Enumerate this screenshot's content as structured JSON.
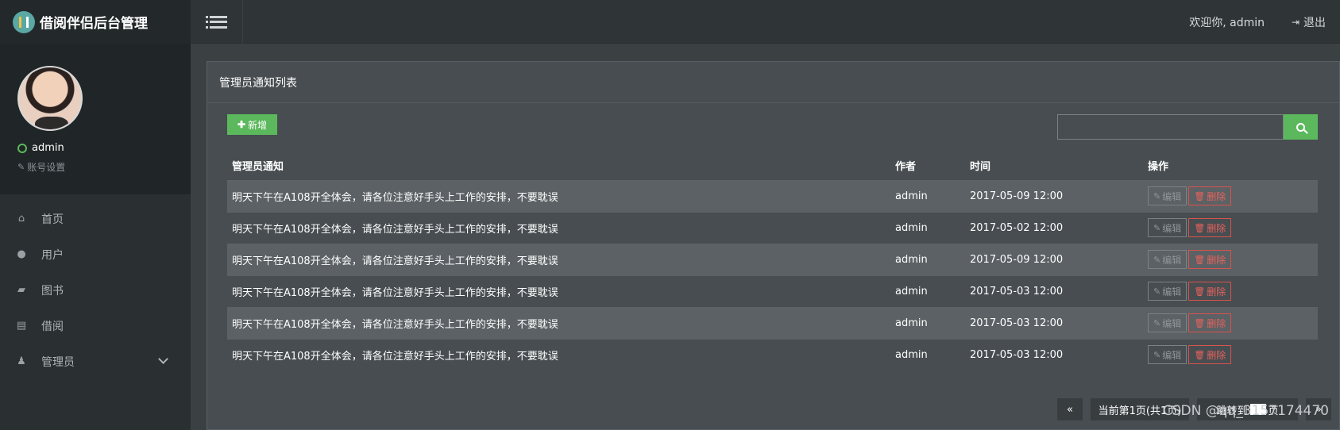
{
  "app": {
    "title": "借阅伴侣后台管理"
  },
  "topbar": {
    "welcome": "欢迎你, admin",
    "logout_label": "退出"
  },
  "profile": {
    "username": "admin",
    "account_settings": "账号设置"
  },
  "sidebar": {
    "items": [
      {
        "label": "首页",
        "icon": "home-icon"
      },
      {
        "label": "用户",
        "icon": "user-icon"
      },
      {
        "label": "图书",
        "icon": "book-icon"
      },
      {
        "label": "借阅",
        "icon": "calendar-icon"
      },
      {
        "label": "管理员",
        "icon": "admin-icon"
      }
    ]
  },
  "panel": {
    "title": "管理员通知列表",
    "add_label": "新增",
    "search_placeholder": ""
  },
  "table": {
    "headers": {
      "title": "管理员通知",
      "author": "作者",
      "time": "时间",
      "actions": "操作"
    },
    "edit_label": "编辑",
    "delete_label": "删除",
    "rows": [
      {
        "title": "明天下午在A108开全体会，请各位注意好手头上工作的安排，不要耽误",
        "author": "admin",
        "time": "2017-05-09 12:00"
      },
      {
        "title": "明天下午在A108开全体会，请各位注意好手头上工作的安排，不要耽误",
        "author": "admin",
        "time": "2017-05-02 12:00"
      },
      {
        "title": "明天下午在A108开全体会，请各位注意好手头上工作的安排，不要耽误",
        "author": "admin",
        "time": "2017-05-09 12:00"
      },
      {
        "title": "明天下午在A108开全体会，请各位注意好手头上工作的安排，不要耽误",
        "author": "admin",
        "time": "2017-05-03 12:00"
      },
      {
        "title": "明天下午在A108开全体会，请各位注意好手头上工作的安排，不要耽误",
        "author": "admin",
        "time": "2017-05-03 12:00"
      },
      {
        "title": "明天下午在A108开全体会，请各位注意好手头上工作的安排，不要耽误",
        "author": "admin",
        "time": "2017-05-03 12:00"
      }
    ]
  },
  "pager": {
    "prev": "«",
    "info": "当前第1页(共1页)",
    "jump_prefix": "跳转到",
    "jump_suffix": "页",
    "next": "»"
  },
  "watermark": "CSDN @qq_3157174470",
  "colors": {
    "accent": "#5cb85c",
    "danger": "#d9534f",
    "sidebar": "#2a2f31",
    "panel": "#474d50"
  }
}
